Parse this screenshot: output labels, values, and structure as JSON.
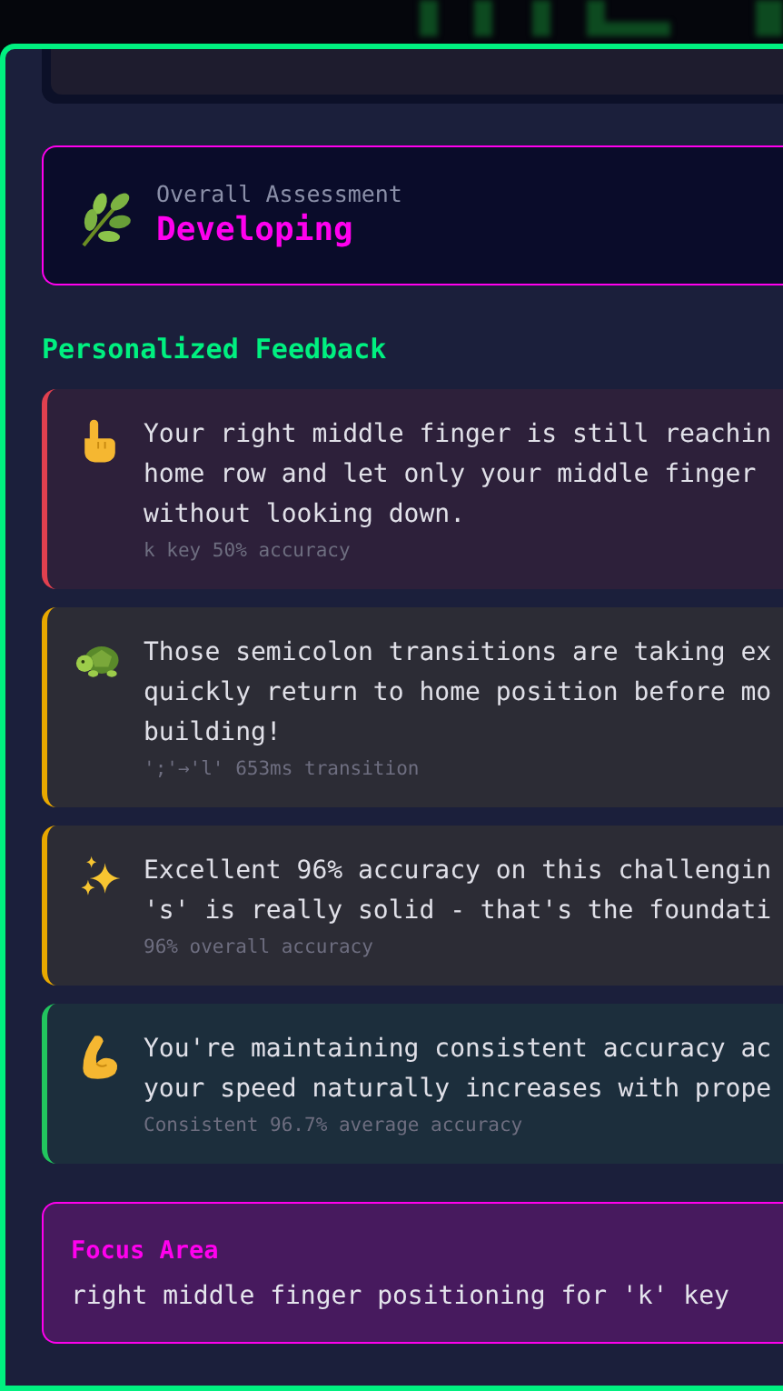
{
  "assessment": {
    "label": "Overall Assessment",
    "value": "Developing"
  },
  "section_title": "Personalized Feedback",
  "feedback": [
    {
      "kind": "finger",
      "color": "#e0404f",
      "lines": [
        "Your right middle finger is still reachin",
        "home row and let only your middle finger",
        "without looking down."
      ],
      "detail": "k key 50% accuracy"
    },
    {
      "kind": "turtle",
      "color": "#e8a800",
      "lines": [
        "Those semicolon transitions are taking ex",
        "quickly return to home position before mo",
        "building!"
      ],
      "detail": "';'→'l' 653ms transition"
    },
    {
      "kind": "sparkles",
      "color": "#e8a800",
      "lines": [
        "Excellent 96% accuracy on this challengin",
        "'s' is really solid - that's the foundati"
      ],
      "detail": "96% overall accuracy"
    },
    {
      "kind": "muscle",
      "color": "#22c55e",
      "lines": [
        "You're maintaining consistent accuracy ac",
        "your speed naturally increases with prope"
      ],
      "detail": "Consistent 96.7% average accuracy"
    }
  ],
  "focus": {
    "label": "Focus Area",
    "text": "right middle finger positioning for 'k' key"
  }
}
